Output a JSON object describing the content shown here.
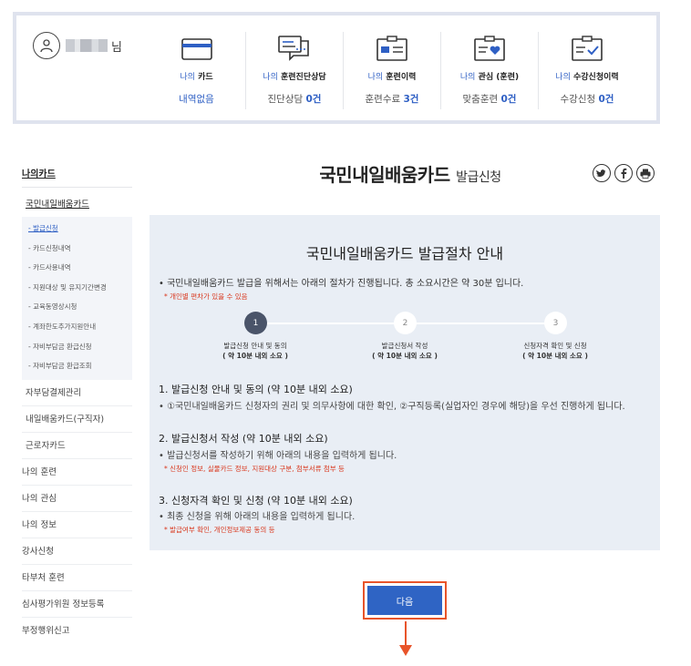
{
  "user": {
    "honorific": "님"
  },
  "stats": [
    {
      "prefix": "나의",
      "label": "카드",
      "value": "내역없음",
      "count": "",
      "icon": "card-icon"
    },
    {
      "prefix": "나의",
      "label": "훈련진단상담",
      "value": "진단상담",
      "count": "0건",
      "icon": "consult-icon"
    },
    {
      "prefix": "나의",
      "label": "훈련이력",
      "value": "훈련수료",
      "count": "3건",
      "icon": "history-icon"
    },
    {
      "prefix": "나의",
      "label": "관심 (훈련)",
      "value": "맞춤훈련",
      "count": "0건",
      "icon": "heart-icon"
    },
    {
      "prefix": "나의",
      "label": "수강신청이력",
      "value": "수강신청",
      "count": "0건",
      "icon": "checklist-icon"
    }
  ],
  "nav": {
    "head": "나의카드",
    "sub": "국민내일배움카드",
    "sub_items": [
      "- 발급신청",
      "- 카드신청내역",
      "- 카드사용내역",
      "- 지원대상 및 유지기간변경",
      "- 교육동영상시청",
      "- 계좌한도추가지원안내",
      "- 자비부담금 환급신청",
      "- 자비부담금 환급조회"
    ],
    "items_indent": [
      "자부담결제관리",
      "내일배움카드(구직자)",
      "근로자카드"
    ],
    "items": [
      "나의 훈련",
      "나의 관심",
      "나의 정보",
      "강사신청",
      "타부처 훈련",
      "심사평가위원 정보등록",
      "부정행위신고"
    ]
  },
  "page": {
    "title_main": "국민내일배움카드",
    "title_sub": "발급신청"
  },
  "share": [
    "twitter-icon",
    "facebook-icon",
    "print-icon"
  ],
  "panel": {
    "heading": "국민내일배움카드 발급절차 안내",
    "intro": "• 국민내일배움카드 발급을 위해서는 아래의 절차가 진행됩니다. 총 소요시간은 약 30분 입니다.",
    "note": "* 개인별 편차가 있을 수 있음",
    "steps": [
      {
        "num": "1",
        "label": "발급신청 안내 및 동의",
        "time": "( 약 10분 내외 소요 )"
      },
      {
        "num": "2",
        "label": "발급신청서 작성",
        "time": "( 약 10분 내외 소요 )"
      },
      {
        "num": "3",
        "label": "신청자격 확인 및 신청",
        "time": "( 약 10분 내외 소요 )"
      }
    ],
    "sections": [
      {
        "title": "1. 발급신청 안내 및 동의 (약 10분 내외 소요)",
        "desc": "• ①국민내일배움카드 신청자의 권리 및 의무사항에 대한 확인, ②구직등록(실업자인 경우에 해당)을 우선 진행하게 됩니다.",
        "note": ""
      },
      {
        "title": "2. 발급신청서 작성 (약 10분 내외 소요)",
        "desc": "• 발급신청서를 작성하기 위해 아래의 내용을 입력하게 됩니다.",
        "note": "* 신청인 정보, 실물카드 정보, 지원대상 구분, 첨부서류 첨부 등"
      },
      {
        "title": "3. 신청자격 확인 및 신청 (약 10분 내외 소요)",
        "desc": "• 최종 신청을 위해 아래의 내용을 입력하게 됩니다.",
        "note": "* 발급여부 확인, 개인정보제공 동의 등"
      }
    ]
  },
  "next_button": "다음",
  "colors": {
    "accent": "#2f64c4",
    "highlight": "#e8542a",
    "panel_bg": "#e9eef5"
  }
}
